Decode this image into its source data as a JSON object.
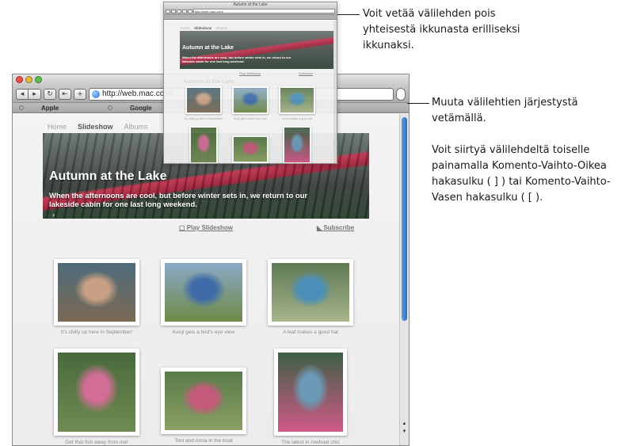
{
  "browser": {
    "url": "http://web.mac.com/",
    "bookmarks": [
      "Apple",
      "Google"
    ],
    "nav_labels": {
      "back": "◂",
      "forward": "▸",
      "reload": "↻",
      "snapback": "⇤",
      "add": "+"
    }
  },
  "site": {
    "nav": [
      "Home",
      "Slideshow",
      "Albums"
    ],
    "hero_title": "Autumn at the Lake",
    "hero_subtitle": "When the afternoons are cool, but before winter sets in, we return to our lakeside cabin for one last long weekend.",
    "hero_arrow": "›",
    "play_slideshow": "Play Slideshow",
    "subscribe": "Subscribe",
    "photos": [
      {
        "caption": "It's chilly up here in September!",
        "colors": [
          "#4f6b7a",
          "#c8a184",
          "#7a6a55"
        ]
      },
      {
        "caption": "Kenji gets a bird's eye view",
        "colors": [
          "#8aa9c6",
          "#3f6aa8",
          "#6f8a48"
        ]
      },
      {
        "caption": "A leaf makes a good hat",
        "colors": [
          "#5f7a56",
          "#4b8fb8",
          "#a7b58a"
        ]
      },
      {
        "caption": "Get that fish away from me!",
        "colors": [
          "#4a6a3c",
          "#d26d95",
          "#6f8b52"
        ]
      },
      {
        "caption": "Toni and Anna in the boat",
        "colors": [
          "#5a7b4a",
          "#c45a7a",
          "#8aa064"
        ]
      },
      {
        "caption": "The latest in rowboat chic",
        "colors": [
          "#3d5f44",
          "#6a9ab6",
          "#d05a88"
        ]
      }
    ]
  },
  "mini": {
    "window_title": "Autumn at the Lake",
    "url": "http://web.mac.com/"
  },
  "callouts": {
    "top": "Voit vetää välilehden pois yhteisestä ikkunasta erilliseksi ikkunaksi.",
    "middle": "Muuta välilehtien järjestystä vetämällä.",
    "bottom": "Voit siirtyä välilehdeltä toiselle painamalla Komento-Vaihto-Oikea hakasulku ( ] ) tai Komento-Vaihto-Vasen hakasulku ( [ )."
  }
}
